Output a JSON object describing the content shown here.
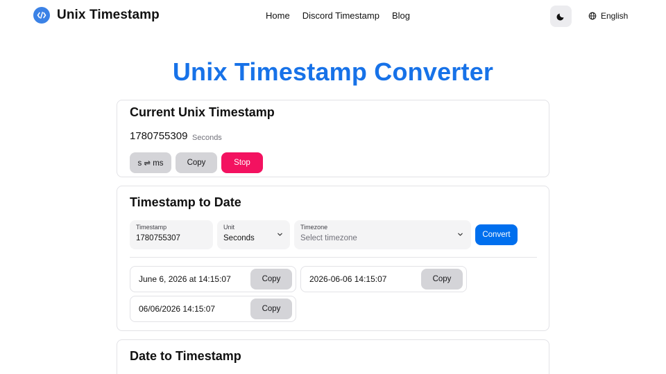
{
  "header": {
    "brand": "Unix Timestamp",
    "nav": [
      "Home",
      "Discord Timestamp",
      "Blog"
    ],
    "language": "English"
  },
  "page_title": "Unix Timestamp Converter",
  "current": {
    "title": "Current Unix Timestamp",
    "value": "1780755309",
    "unit": "Seconds",
    "buttons": {
      "toggle": "s ⇌ ms",
      "copy": "Copy",
      "stop": "Stop"
    }
  },
  "ts_to_date": {
    "title": "Timestamp to Date",
    "timestamp_label": "Timestamp",
    "timestamp_value": "1780755307",
    "unit_label": "Unit",
    "unit_value": "Seconds",
    "timezone_label": "Timezone",
    "timezone_placeholder": "Select timezone",
    "convert": "Convert",
    "results": [
      {
        "text": "June 6, 2026 at 14:15:07",
        "copy": "Copy"
      },
      {
        "text": "2026-06-06 14:15:07",
        "copy": "Copy"
      },
      {
        "text": "06/06/2026 14:15:07",
        "copy": "Copy"
      }
    ]
  },
  "date_to_ts": {
    "title": "Date to Timestamp"
  },
  "colors": {
    "accent": "#1772e8",
    "primary_button": "#006fee",
    "stop_button": "#f31260",
    "logo": "#3b82e6"
  },
  "icons": {
    "logo": "code-icon",
    "theme": "moon-icon",
    "language": "globe-icon",
    "select": "chevron-down-icon"
  }
}
